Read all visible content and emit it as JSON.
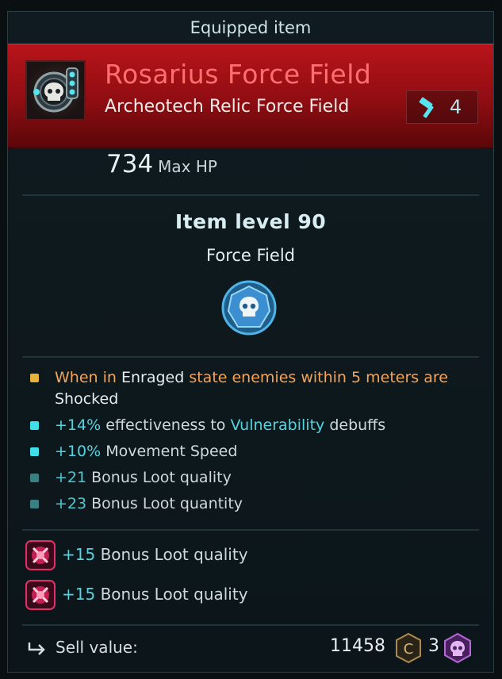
{
  "header": {
    "title": "Equipped item"
  },
  "item": {
    "name": "Rosarius Force Field",
    "subtitle": "Archeotech Relic Force Field",
    "upgrade_count": "4",
    "icon": "skull-force-field-icon"
  },
  "stat": {
    "value": "734",
    "label": "Max HP"
  },
  "item_level": "Item level 90",
  "item_type": "Force Field",
  "modifiers": [
    {
      "bullet_color": "#e8b13c",
      "parts": [
        "When in ",
        "Enraged",
        " state enemies within 5 meters are ",
        "Shocked"
      ]
    },
    {
      "bullet_color": "#3fe0ea",
      "parts": [
        "+14%",
        " effectiveness to ",
        "Vulnerability",
        " debuffs"
      ]
    },
    {
      "bullet_color": "#3fe0ea",
      "parts": [
        "+10%",
        " Movement Speed"
      ]
    },
    {
      "bullet_color": "#3a7f82",
      "parts": [
        "+21",
        " Bonus Loot quality"
      ]
    },
    {
      "bullet_color": "#3a7f82",
      "parts": [
        "+23",
        " Bonus Loot quantity"
      ]
    }
  ],
  "sockets": [
    {
      "value": "+15",
      "label": " Bonus Loot quality",
      "icon": "pink-gem-icon"
    },
    {
      "value": "+15",
      "label": " Bonus Loot quality",
      "icon": "pink-gem-icon"
    }
  ],
  "footer": {
    "sell_label": "Sell value:",
    "sell_amount": "11458",
    "resource_amount": "3"
  },
  "colors": {
    "banner": "#b8141a",
    "name": "#ff6f6f",
    "accent_cyan": "#56d3e0",
    "accent_orange": "#f3a45b"
  }
}
